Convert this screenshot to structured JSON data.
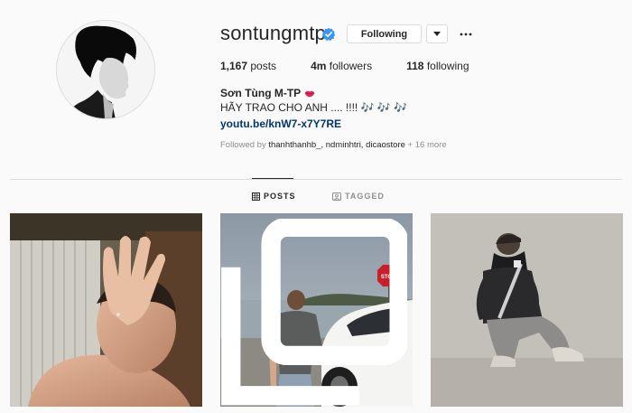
{
  "profile": {
    "username": "sontungmtp",
    "verified": true,
    "following_label": "Following",
    "posts_count": "1,167",
    "posts_label": "posts",
    "followers_count": "4m",
    "followers_label": "followers",
    "following_count": "118",
    "following_count_label": "following",
    "full_name": "Sơn Tùng M-TP",
    "bio": "HÃY TRAO CHO ANH .... !!!! 🎶 🎶 🎶",
    "link": "youtu.be/knW7-x7Y7RE",
    "followed_by_prefix": "Followed by ",
    "followed_by_names": "thanhthanhb_, ndminhtri, dicaostore",
    "followed_by_suffix": " + 16 more"
  },
  "tabs": {
    "posts": "POSTS",
    "tagged": "TAGGED"
  },
  "icons": {
    "verified": "verified-badge-icon",
    "dropdown": "chevron-down-icon",
    "more": "more-options-icon",
    "posts_tab": "grid-icon",
    "tagged_tab": "tagged-icon",
    "multi_post": "carousel-icon"
  },
  "colors": {
    "background": "#fafafa",
    "verified_blue": "#3897f0",
    "link": "#00376b",
    "muted": "#8e8e8e",
    "border": "#dbdbdb"
  }
}
